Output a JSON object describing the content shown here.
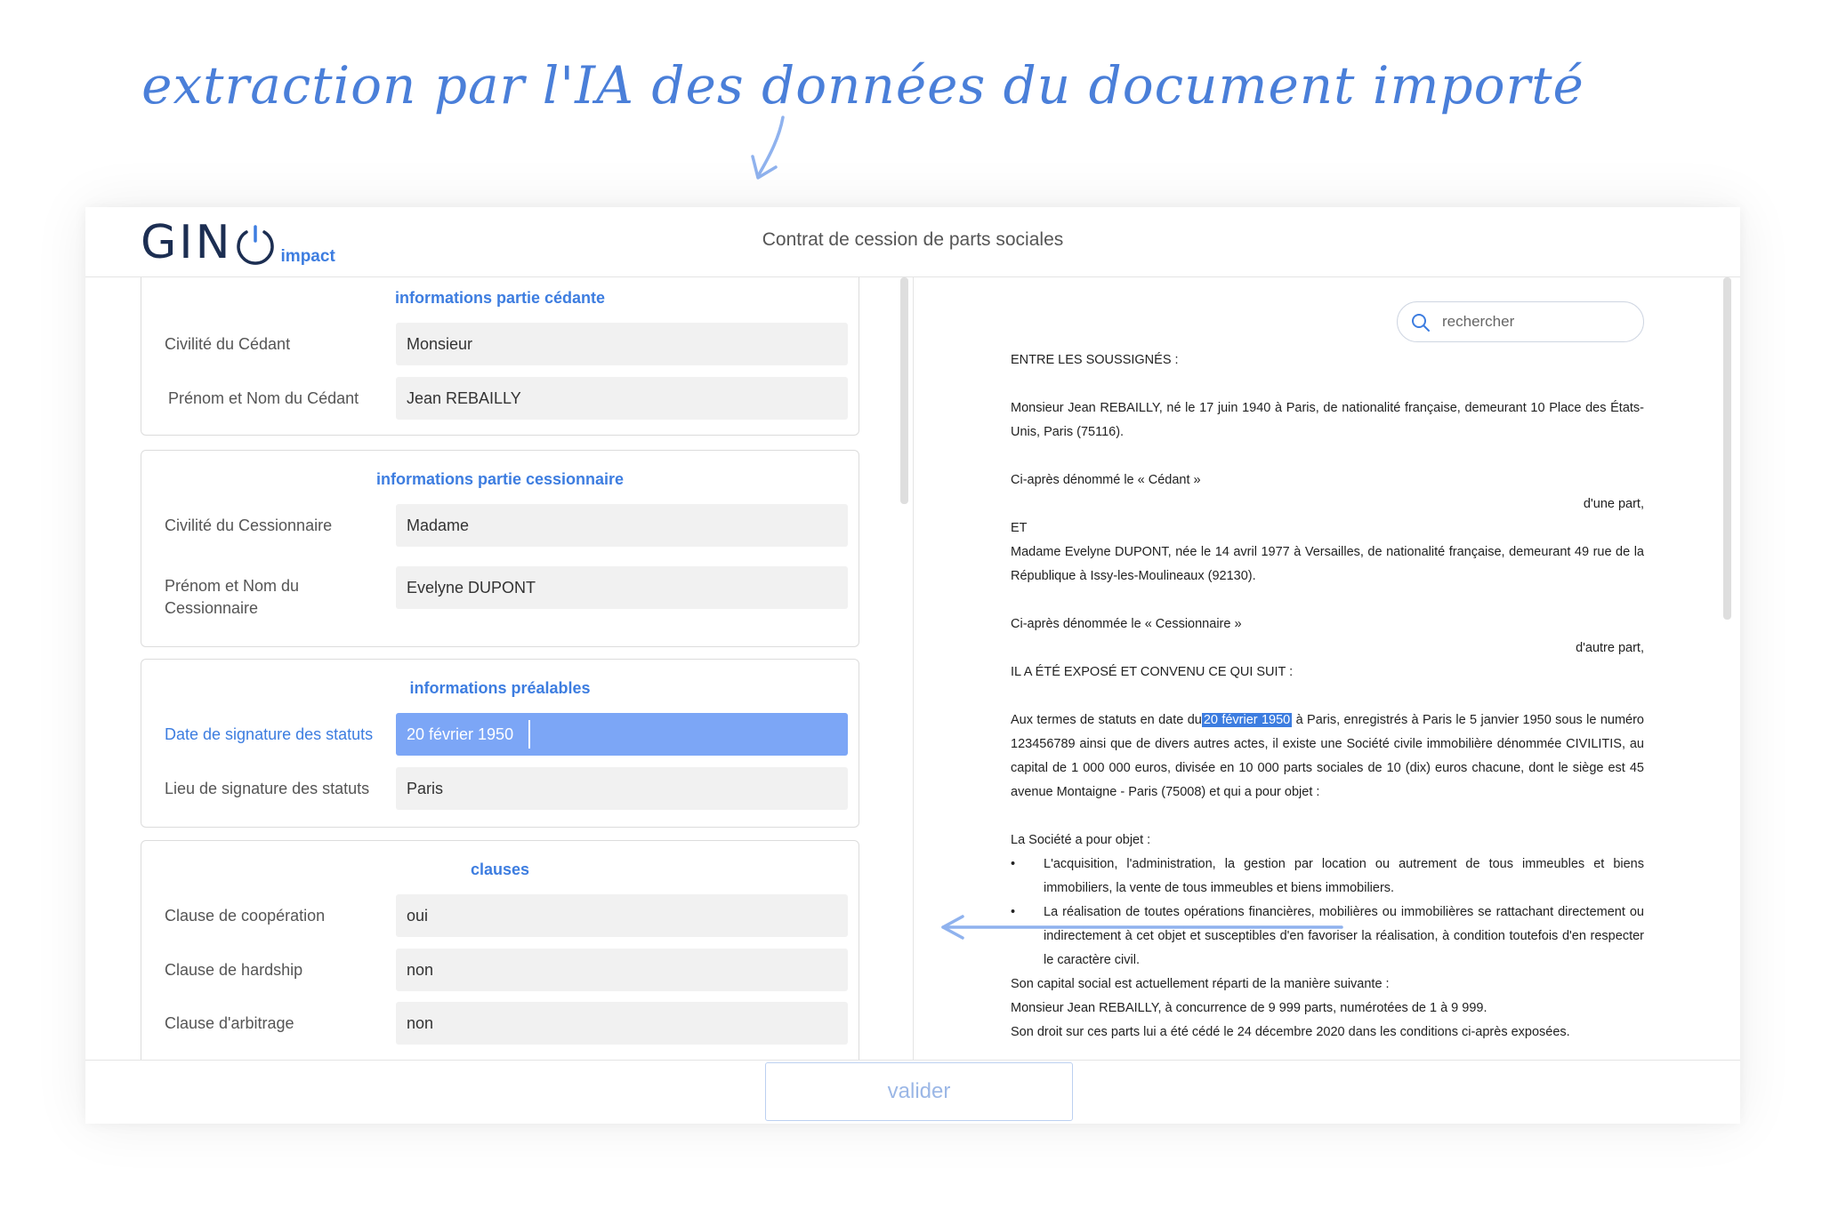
{
  "caption": "extraction par l'IA des données du document importé",
  "header": {
    "logo_main": "GIN",
    "logo_sub": "impact",
    "title": "Contrat de cession de parts sociales"
  },
  "cards": {
    "cedante": {
      "title": "informations partie cédante",
      "f1_label": "Civilité du Cédant",
      "f1_value": "Monsieur",
      "f2_label": "Prénom et Nom du Cédant",
      "f2_value": "Jean REBAILLY"
    },
    "cessionnaire": {
      "title": "informations partie cessionnaire",
      "f1_label": "Civilité du Cessionnaire",
      "f1_value": "Madame",
      "f2_label": "Prénom et Nom du Cessionnaire",
      "f2_value": "Evelyne DUPONT"
    },
    "prealables": {
      "title": "informations préalables",
      "f1_label": "Date de signature des statuts",
      "f1_value": "20 février 1950",
      "f2_label": "Lieu de signature des statuts",
      "f2_value": "Paris"
    },
    "clauses": {
      "title": "clauses",
      "f1_label": "Clause de coopération",
      "f1_value": "oui",
      "f2_label": "Clause de hardship",
      "f2_value": "non",
      "f3_label": "Clause d'arbitrage",
      "f3_value": "non"
    }
  },
  "search": {
    "placeholder": "rechercher"
  },
  "document": {
    "p1": "ENTRE LES SOUSSIGNÉS :",
    "p2": "Monsieur Jean REBAILLY, né le 17 juin 1940 à Paris, de nationalité française, demeurant 10 Place des États-Unis, Paris (75116).",
    "p3": "Ci-après dénommé le « Cédant »",
    "p4": "d'une part,",
    "p5": "ET",
    "p6": "Madame Evelyne DUPONT, née le 14 avril 1977 à Versailles, de nationalité française, demeurant 49 rue de la République à Issy-les-Moulineaux (92130).",
    "p7": "Ci-après dénommée le « Cessionnaire »",
    "p8": "d'autre part,",
    "p9": "IL A ÉTÉ EXPOSÉ ET CONVENU CE QUI SUIT :",
    "p10_before": "Aux termes de statuts en date du",
    "p10_highlight": "20 février 1950",
    "p10_after": " à Paris, enregistrés à Paris le 5 janvier 1950 sous le numéro 123456789 ainsi que de divers autres actes, il existe une Société civile immobilière dénommée CIVILITIS, au capital de 1 000 000 euros, divisée en 10 000 parts sociales de 10 (dix) euros chacune, dont le siège est 45 avenue Montaigne - Paris (75008) et qui a pour objet :",
    "p11": "La Société a pour objet :",
    "bullet_char": "•",
    "b1": "L'acquisition, l'administration, la gestion par location ou autrement de tous immeubles et biens immobiliers, la vente de tous immeubles et biens immobiliers.",
    "b2": "La réalisation de toutes opérations financières, mobilières ou immobilières se rattachant directement ou indirectement à cet objet et susceptibles d'en favoriser la réalisation, à condition toutefois d'en respecter le caractère civil.",
    "p12": "Son capital social est actuellement réparti de la manière suivante :",
    "p13": "Monsieur Jean REBAILLY, à concurrence de 9 999 parts, numérotées de 1 à 9 999.",
    "p14": "Son droit sur ces parts lui a été cédé le 24 décembre 2020 dans les conditions ci-après exposées."
  },
  "footer": {
    "validate_label": "valider"
  },
  "colors": {
    "accent": "#3d7de0",
    "highlight_field": "#7ca6f6",
    "logo": "#1c2e52"
  },
  "icons": {
    "search": "search-icon",
    "caption_arrow": "arrow-down-icon",
    "link_arrow": "arrow-left-icon"
  }
}
